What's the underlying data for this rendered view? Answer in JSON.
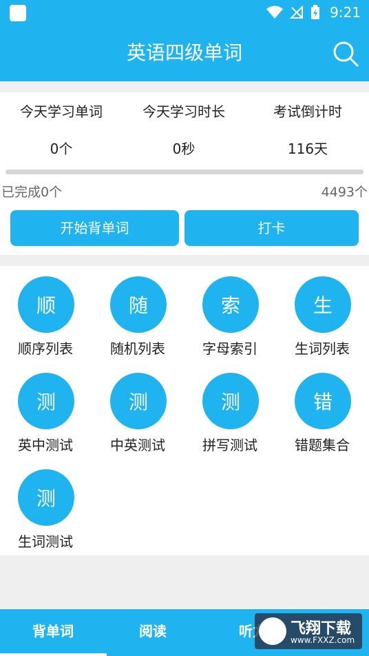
{
  "status_bar": {
    "time": "9:21",
    "icons": [
      "notification-icon",
      "wifi-icon",
      "no-signal-icon",
      "battery-charging-icon"
    ]
  },
  "app_bar": {
    "title": "英语四级单词",
    "search_icon": "search-icon"
  },
  "stats": {
    "items": [
      {
        "label": "今天学习单词",
        "value": "0个"
      },
      {
        "label": "今天学习时长",
        "value": "0秒"
      },
      {
        "label": "考试倒计时",
        "value": "116天"
      }
    ],
    "progress_fraction": 0,
    "done_text": "已完成0个",
    "total_text": "4493个"
  },
  "actions": {
    "start_label": "开始背单词",
    "checkin_label": "打卡"
  },
  "grid": {
    "items": [
      {
        "glyph": "顺",
        "label": "顺序列表"
      },
      {
        "glyph": "随",
        "label": "随机列表"
      },
      {
        "glyph": "索",
        "label": "字母索引"
      },
      {
        "glyph": "生",
        "label": "生词列表"
      },
      {
        "glyph": "测",
        "label": "英中测试"
      },
      {
        "glyph": "测",
        "label": "中英测试"
      },
      {
        "glyph": "测",
        "label": "拼写测试"
      },
      {
        "glyph": "错",
        "label": "错题集合"
      },
      {
        "glyph": "测",
        "label": "生词测试"
      }
    ]
  },
  "bottom_nav": {
    "tabs": [
      {
        "label": "背单词"
      },
      {
        "label": "阅读"
      },
      {
        "label": "听力"
      }
    ]
  },
  "watermark": {
    "text": "飞翔下载",
    "url": "www.FXXZ.com"
  },
  "colors": {
    "accent": "#1fb4ef",
    "background": "#efefef",
    "card": "#ffffff"
  }
}
